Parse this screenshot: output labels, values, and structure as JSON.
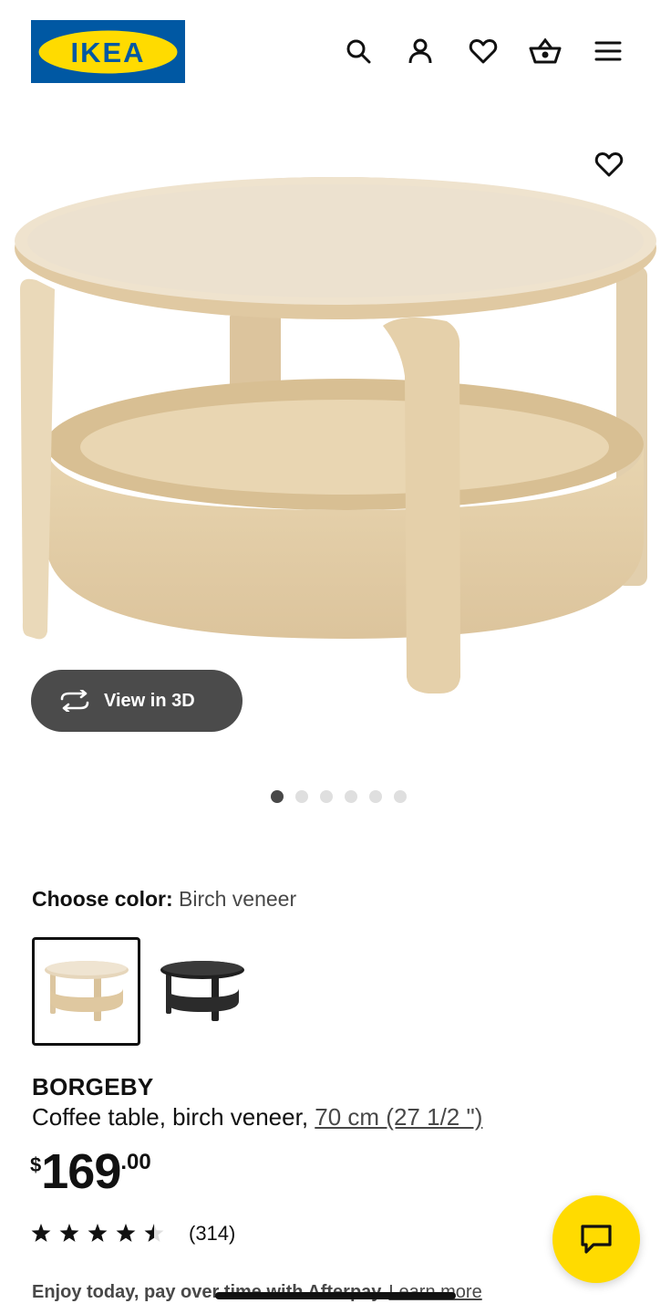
{
  "header": {
    "logo_text": "IKEA",
    "icons": [
      "search-icon",
      "account-icon",
      "heart-icon",
      "basket-icon",
      "menu-icon"
    ]
  },
  "hero": {
    "view3d_label": "View in 3D",
    "carousel": {
      "total": 6,
      "active": 1
    }
  },
  "color": {
    "label": "Choose color:",
    "value": "Birch veneer",
    "options": [
      "Birch veneer",
      "Black"
    ]
  },
  "product": {
    "name": "BORGEBY",
    "description": "Coffee table, birch veneer, ",
    "size": "70 cm (27 1/2 \")",
    "price_currency": "$",
    "price_integer": "169",
    "price_decimal": ".00"
  },
  "rating": {
    "stars": 4.5,
    "count": "(314)"
  },
  "afterpay": {
    "text": "Enjoy today, pay over time with Afterpay",
    "link": "Learn more"
  },
  "colors": {
    "ikea_blue": "#0058a3",
    "ikea_yellow": "#ffdb00",
    "button_dark": "#4b4b4b"
  }
}
